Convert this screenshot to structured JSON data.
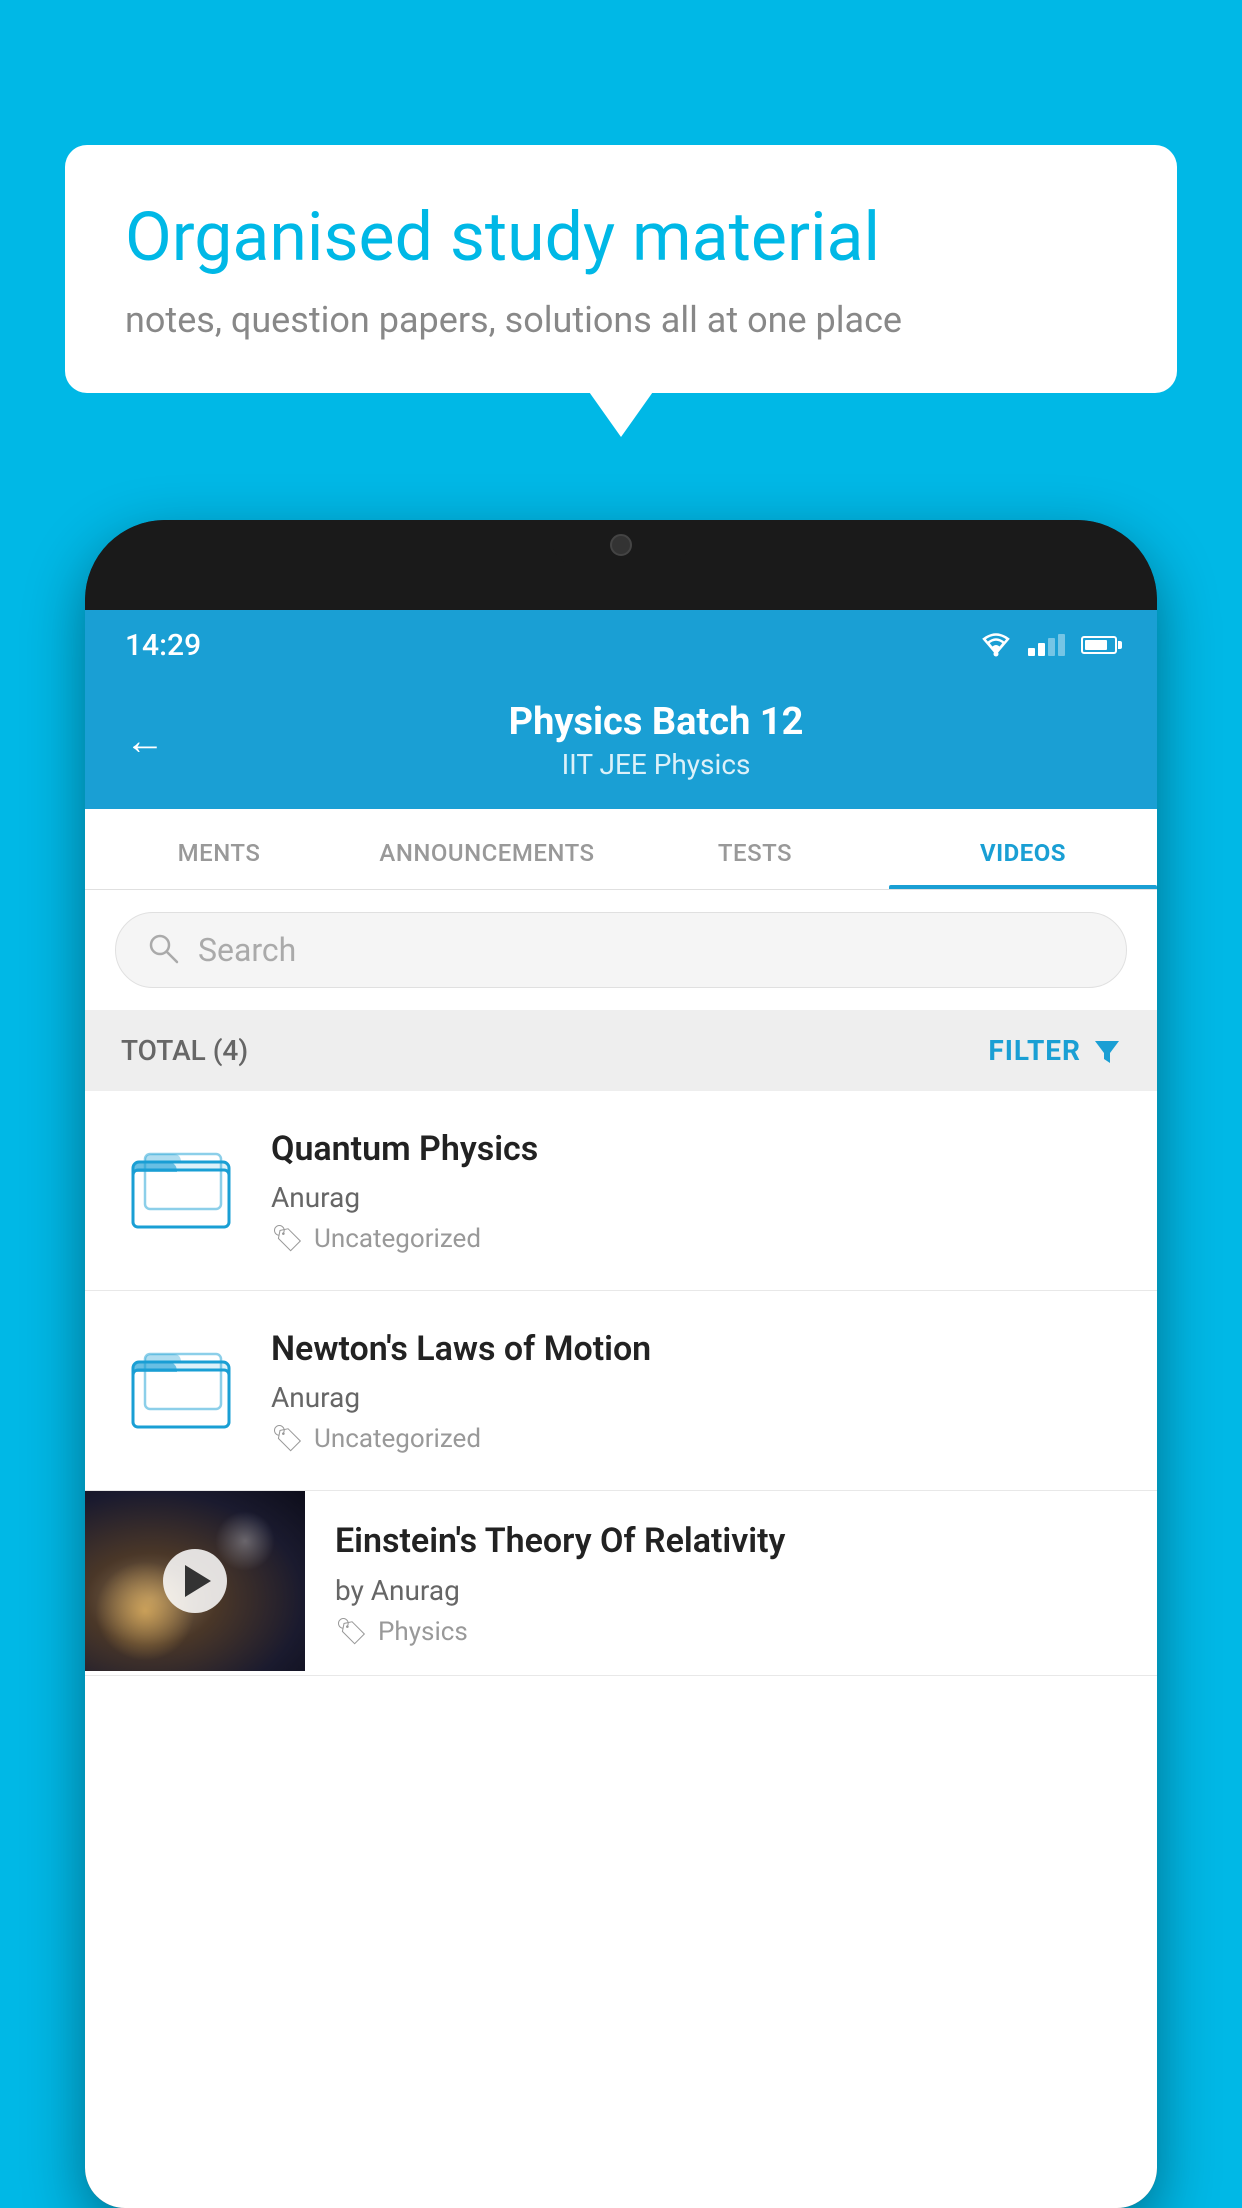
{
  "background": {
    "color": "#00B8E6"
  },
  "speech_bubble": {
    "title": "Organised study material",
    "subtitle": "notes, question papers, solutions all at one place"
  },
  "phone": {
    "status_bar": {
      "time": "14:29"
    },
    "header": {
      "title": "Physics Batch 12",
      "subtitle": "IIT JEE   Physics",
      "back_label": "←"
    },
    "tabs": [
      {
        "label": "MENTS",
        "active": false
      },
      {
        "label": "ANNOUNCEMENTS",
        "active": false
      },
      {
        "label": "TESTS",
        "active": false
      },
      {
        "label": "VIDEOS",
        "active": true
      }
    ],
    "search": {
      "placeholder": "Search"
    },
    "filter": {
      "total_label": "TOTAL (4)",
      "filter_label": "FILTER"
    },
    "videos": [
      {
        "id": 1,
        "title": "Quantum Physics",
        "author": "Anurag",
        "tag": "Uncategorized",
        "has_thumbnail": false
      },
      {
        "id": 2,
        "title": "Newton's Laws of Motion",
        "author": "Anurag",
        "tag": "Uncategorized",
        "has_thumbnail": false
      },
      {
        "id": 3,
        "title": "Einstein's Theory Of Relativity",
        "author": "by Anurag",
        "tag": "Physics",
        "has_thumbnail": true
      }
    ]
  }
}
